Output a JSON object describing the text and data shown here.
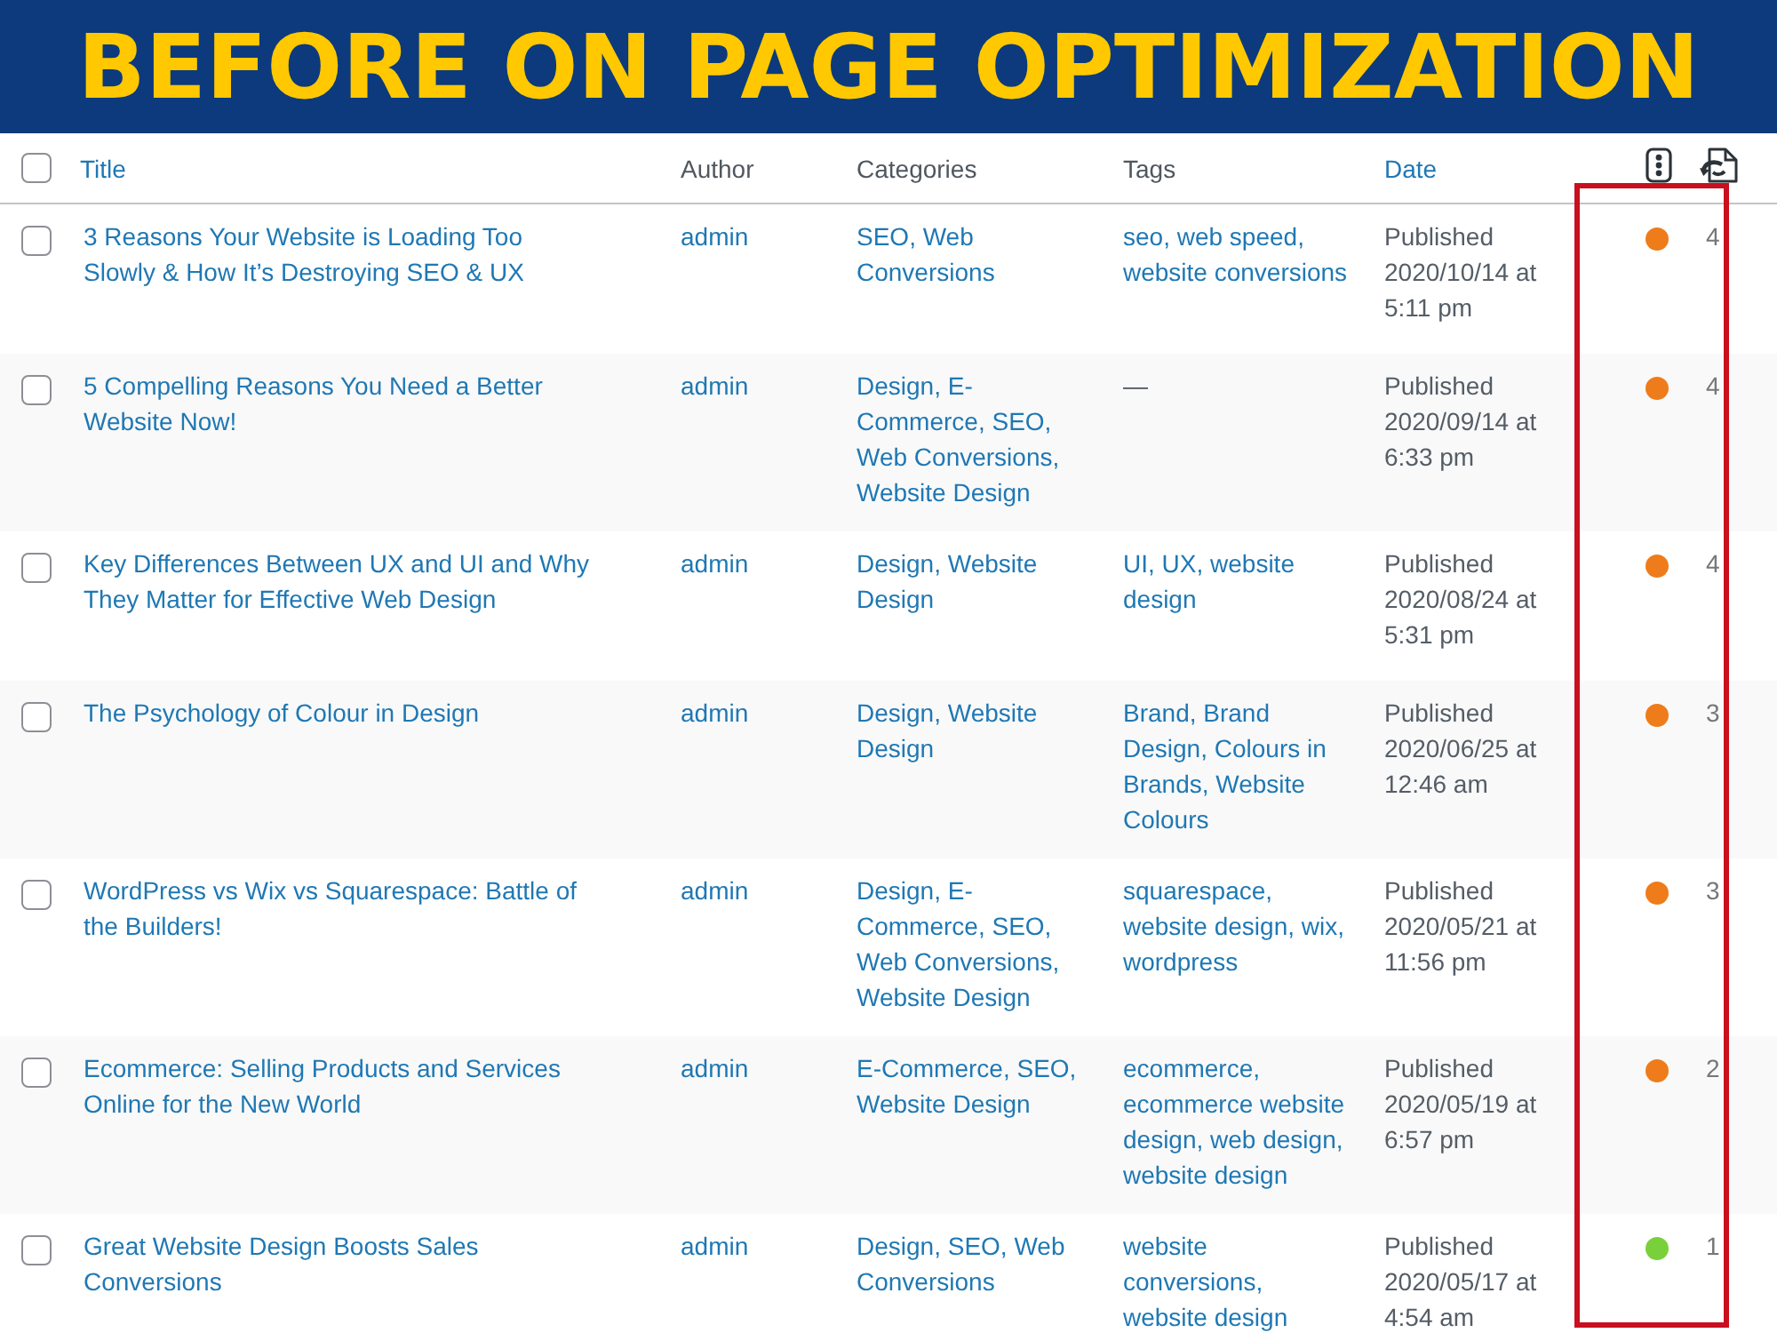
{
  "banner": {
    "title": "BEFORE ON PAGE OPTIMIZATION"
  },
  "table": {
    "select_all": {
      "checked": false
    },
    "columns": [
      {
        "label": "Title",
        "sortable": true
      },
      {
        "label": "Author",
        "sortable": false
      },
      {
        "label": "Categories",
        "sortable": false
      },
      {
        "label": "Tags",
        "sortable": false
      },
      {
        "label": "Date",
        "sortable": true
      }
    ],
    "rows": [
      {
        "checked": false,
        "title": "3 Reasons Your Website is Loading Too Slowly & How It’s Destroying SEO & UX",
        "author": "admin",
        "categories": "SEO, Web Conversions",
        "tags": {
          "kind": "links",
          "text": "seo, web speed, website conversions"
        },
        "status": "Published",
        "date": "2020/10/14 at 5:11 pm",
        "color": "#ee7c1b",
        "column_8": "4"
      },
      {
        "checked": false,
        "title": "5 Compelling Reasons You Need a Better Website Now!",
        "author": "admin",
        "categories": "Design, E-Commerce, SEO, Web Conversions, Website Design",
        "tags": {
          "kind": "none",
          "text": "—"
        },
        "status": "Published",
        "date": "2020/09/14 at 6:33 pm",
        "color": "#ee7c1b",
        "column_8": "4"
      },
      {
        "checked": false,
        "title": "Key Differences Between UX and UI and Why They Matter for Effective Web Design",
        "author": "admin",
        "categories": "Design, Website Design",
        "tags": {
          "kind": "links",
          "text": "UI, UX, website design"
        },
        "status": "Published",
        "date": "2020/08/24 at 5:31 pm",
        "color": "#ee7c1b",
        "column_8": "4"
      },
      {
        "checked": false,
        "title": "The Psychology of Colour in Design",
        "author": "admin",
        "categories": "Design, Website Design",
        "tags": {
          "kind": "links",
          "text": "Brand, Brand Design, Colours in Brands, Website Colours"
        },
        "status": "Published",
        "date": "2020/06/25 at 12:46 am",
        "color": "#ee7c1b",
        "column_8": "3"
      },
      {
        "checked": false,
        "title": "WordPress vs Wix vs Squarespace: Battle of the Builders!",
        "author": "admin",
        "categories": "Design, E-Commerce, SEO, Web Conversions, Website Design",
        "tags": {
          "kind": "links",
          "text": "squarespace, website design, wix, wordpress"
        },
        "status": "Published",
        "date": "2020/05/21 at 11:56 pm",
        "color": "#ee7c1b",
        "column_8": "3"
      },
      {
        "checked": false,
        "title": "Ecommerce: Selling Products and Services Online for the New World",
        "author": "admin",
        "categories": "E-Commerce, SEO, Website Design",
        "tags": {
          "kind": "links",
          "text": "ecommerce, ecommerce website design, web design, website design"
        },
        "status": "Published",
        "date": "2020/05/19 at 6:57 pm",
        "color": "#ee7c1b",
        "column_8": "2"
      },
      {
        "checked": false,
        "title": "Great Website Design Boosts Sales Conversions",
        "author": "admin",
        "categories": "Design, SEO, Web Conversions",
        "tags": {
          "kind": "links",
          "text": "website conversions, website design"
        },
        "status": "Published",
        "date": "2020/05/17 at 4:54 am",
        "color": "#7ad03a",
        "column_8": "1"
      }
    ]
  }
}
